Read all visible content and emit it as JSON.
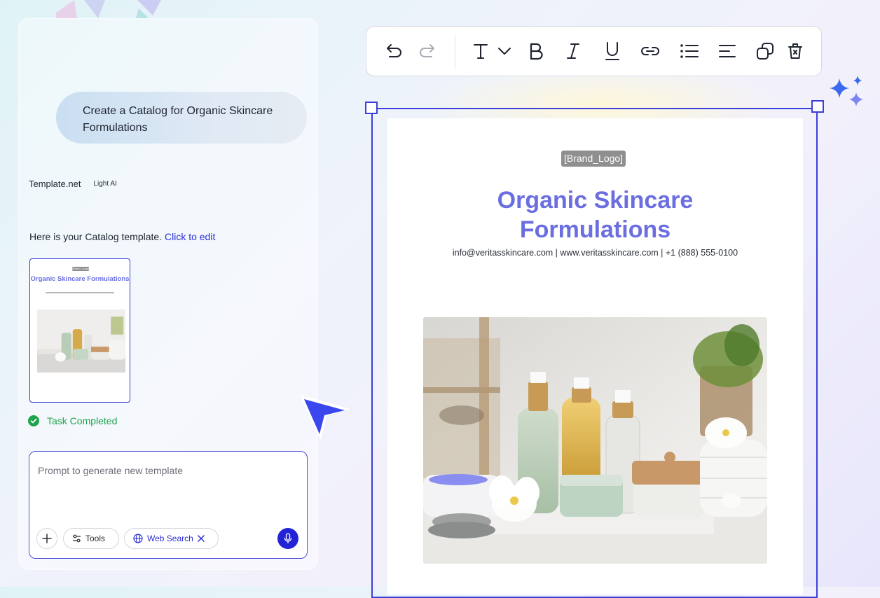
{
  "chat": {
    "user_message": "Create a Catalog for Organic Skincare Formulations",
    "brand": "Template.net",
    "model_tag": "Light AI",
    "reply_text": "Here is your Catalog template.",
    "reply_link": "Click to edit",
    "status": "Task Completed",
    "thumbnail": {
      "logo": "[Brand_Logo]",
      "title": "Organic Skincare Formulations"
    }
  },
  "prompt": {
    "placeholder": "Prompt to generate new template",
    "value": "",
    "tools_label": "Tools",
    "web_search_label": "Web Search"
  },
  "toolbar": {
    "icons": [
      "undo-icon",
      "redo-icon",
      "text-type-icon",
      "chevron-down-icon",
      "bold-icon",
      "italic-icon",
      "underline-icon",
      "link-icon",
      "bulleted-list-icon",
      "align-left-icon",
      "duplicate-icon",
      "delete-icon"
    ]
  },
  "document": {
    "logo": "[Brand_Logo]",
    "title": "Organic Skincare Formulations",
    "contact": "info@veritasskincare.com | www.veritasskincare.com | +1 (888) 555-0100"
  },
  "colors": {
    "accent": "#3c3fd8",
    "title": "#6a6ee0",
    "success": "#1fa34a",
    "link": "#2b2fd9"
  }
}
